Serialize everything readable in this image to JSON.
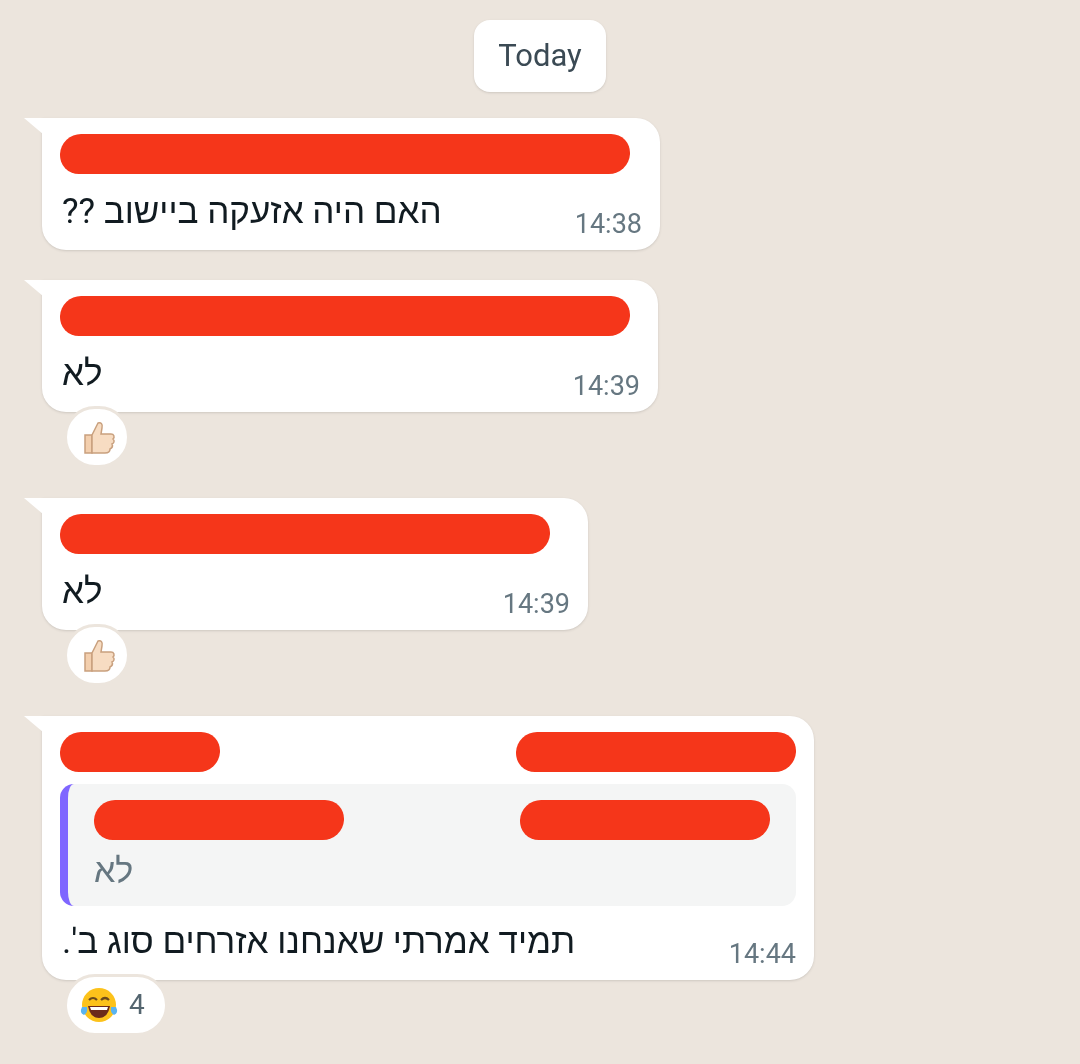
{
  "date_chip": "Today",
  "messages": [
    {
      "sender": {
        "name_redacted": true,
        "phone_redacted": false
      },
      "text": "האם היה אזעקה ביישוב ??",
      "time": "14:38"
    },
    {
      "sender": {
        "name_redacted": true,
        "phone_redacted": false
      },
      "text": "לא",
      "time": "14:39",
      "reaction": {
        "kind": "thumbs_up"
      }
    },
    {
      "sender": {
        "name_redacted": true,
        "phone_redacted": false
      },
      "text": "לא",
      "time": "14:39",
      "reaction": {
        "kind": "thumbs_up"
      }
    },
    {
      "sender": {
        "name_redacted": true,
        "phone_redacted": true
      },
      "quote": {
        "sender": {
          "name_redacted": true,
          "phone_redacted": true
        },
        "text": "לא"
      },
      "text": "תמיד אמרתי שאנחנו אזרחים סוג ב'.",
      "time": "14:44",
      "reaction": {
        "kind": "laughing",
        "count": "4"
      }
    }
  ]
}
